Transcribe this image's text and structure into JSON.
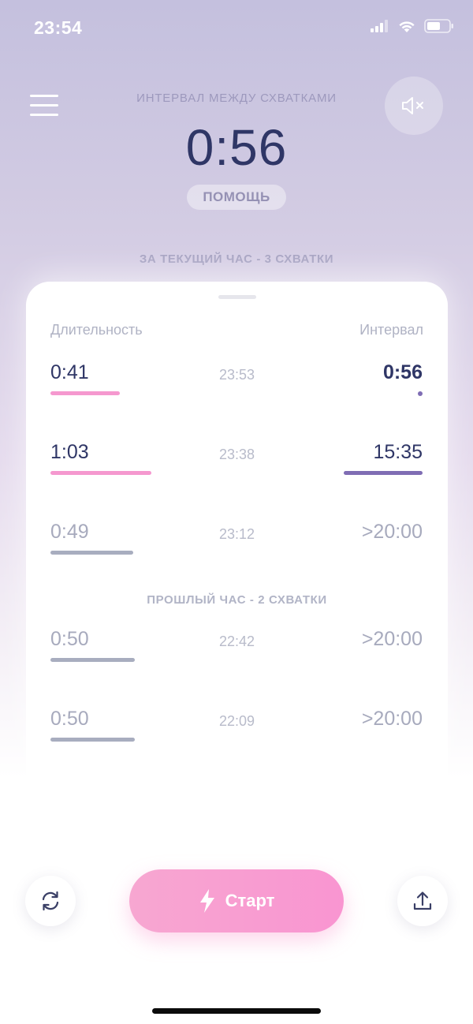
{
  "status_bar": {
    "time": "23:54"
  },
  "header": {
    "interval_label": "ИНТЕРВАЛ МЕЖДУ СХВАТКАМИ",
    "interval_value": "0:56",
    "help_label": "ПОМОЩЬ"
  },
  "current_hour_label": "ЗА ТЕКУЩИЙ ЧАС - 3 СХВАТКИ",
  "table": {
    "duration_header": "Длительность",
    "interval_header": "Интервал",
    "current_hour_rows": [
      {
        "duration": "0:41",
        "time": "23:53",
        "interval": "0:56"
      },
      {
        "duration": "1:03",
        "time": "23:38",
        "interval": "15:35"
      },
      {
        "duration": "0:49",
        "time": "23:12",
        "interval": ">20:00"
      }
    ],
    "previous_hour_label": "ПРОШЛЫЙ ЧАС - 2 СХВАТКИ",
    "previous_hour_rows": [
      {
        "duration": "0:50",
        "time": "22:42",
        "interval": ">20:00"
      },
      {
        "duration": "0:50",
        "time": "22:09",
        "interval": ">20:00"
      }
    ]
  },
  "bottom_bar": {
    "start_label": "Старт"
  },
  "icons": [
    "menu-icon",
    "sound-off-icon",
    "refresh-icon",
    "lightning-icon",
    "share-icon"
  ],
  "colors": {
    "accent_pink": "#f995d1",
    "accent_purple": "#7f6db4",
    "text_dark": "#2f3666",
    "text_muted": "#a7aabd"
  }
}
